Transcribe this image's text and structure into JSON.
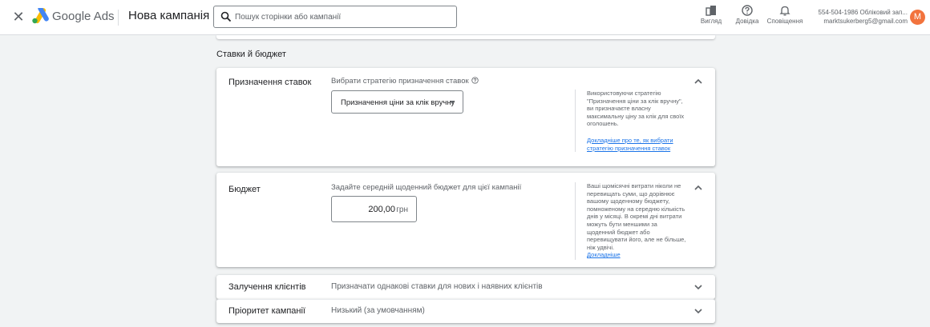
{
  "header": {
    "brand": "Google Ads",
    "campaign_title": "Нова кампанія",
    "search_placeholder": "Пошук сторінки або кампанії",
    "icons": [
      {
        "name": "view-icon",
        "label": "Вигляд"
      },
      {
        "name": "help-icon",
        "label": "Довідка"
      },
      {
        "name": "bell-icon",
        "label": "Сповіщення"
      }
    ],
    "account_id": "554-504-1986 Обліковий зап...",
    "account_email": "marktsukerberg5@gmail.com",
    "avatar_letter": "M",
    "avatar_color": "#f2733d"
  },
  "section": {
    "title": "Ставки й бюджет"
  },
  "bidding": {
    "label": "Призначення ставок",
    "prompt": "Вибрати стратегію призначення ставок",
    "strategy_value": "Призначення ціни за клік вручну",
    "note": "Використовуючи стратегію \"Призначення ціни за клік вручну\", ви призначаєте власну максимальну ціну за клік для своїх оголошень.",
    "link": "Докладніше про те, як вибрати стратегію призначення ставок"
  },
  "budget": {
    "label": "Бюджет",
    "prompt": "Задайте середній щоденний бюджет для цієї кампанії",
    "amount": "200,00",
    "currency": "грн",
    "note": "Ваші щомісячні витрати ніколи не перевищать суми, що дорівнює вашому щоденному бюджету, помноженому на середню кількість днів у місяці. В окремі дні витрати можуть бути меншими за щоденний бюджет або перевищувати його, але не більше, ніж удвічі.",
    "link": "Докладніше"
  },
  "customer_acquisition": {
    "label": "Залучення клієнтів",
    "value": "Призначати однакові ставки для нових і наявних клієнтів"
  },
  "priority": {
    "label": "Пріоритет кампанії",
    "value": "Низький (за умовчанням)"
  },
  "colors": {
    "accent": "#1a73e8",
    "background": "#f1f3f4"
  }
}
